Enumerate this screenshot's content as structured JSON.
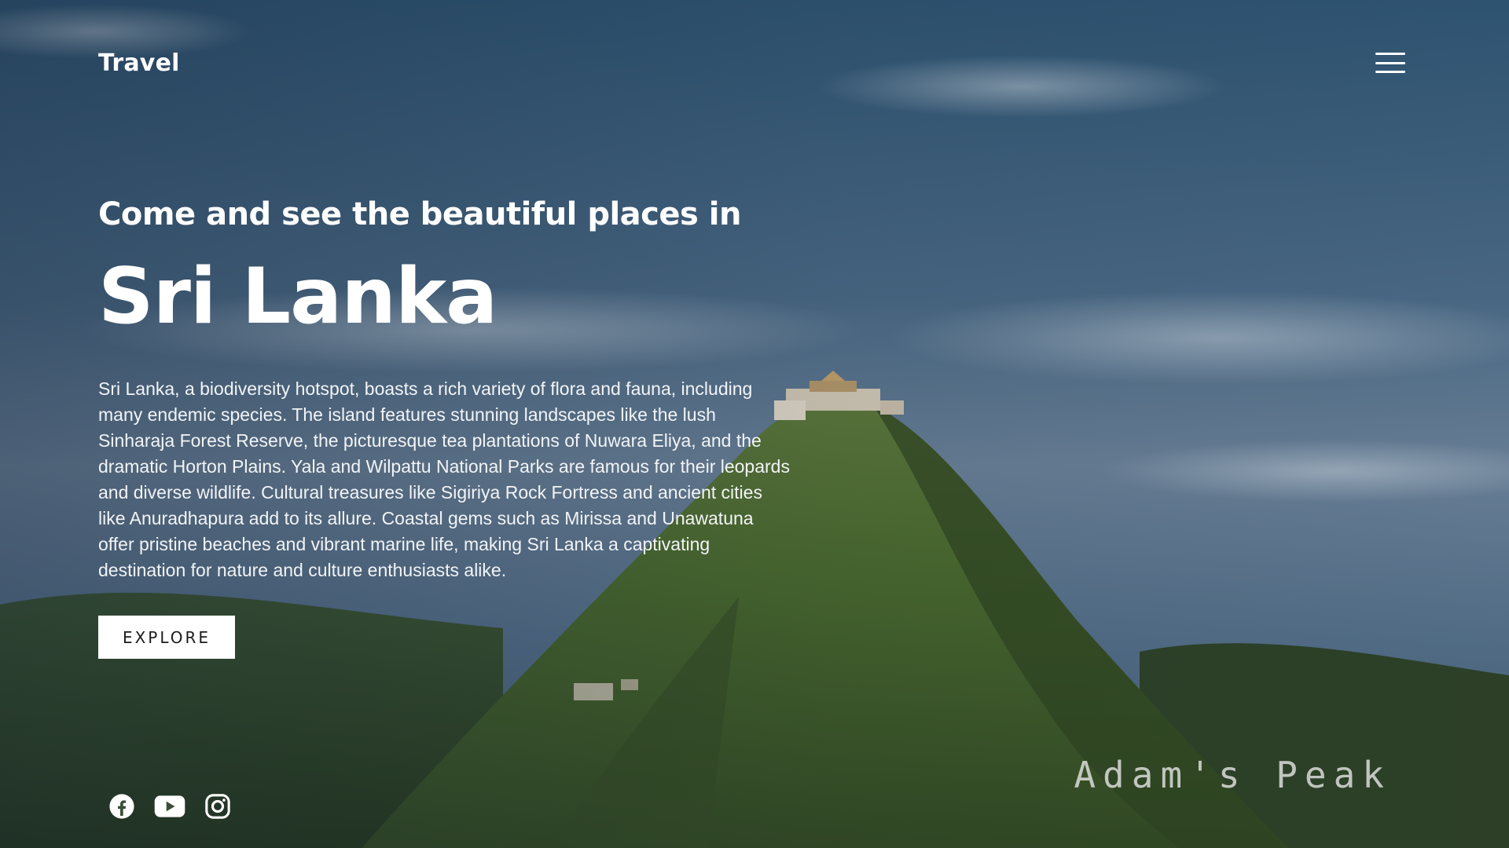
{
  "header": {
    "brand": "Travel",
    "menu_icon": "hamburger-menu-icon"
  },
  "hero": {
    "subtitle": "Come and see the beautiful places in",
    "title": "Sri Lanka",
    "description": "Sri Lanka, a biodiversity hotspot, boasts a rich variety of flora and fauna, including many endemic species. The island features stunning landscapes like the lush Sinharaja Forest Reserve, the picturesque tea plantations of Nuwara Eliya, and the dramatic Horton Plains. Yala and Wilpattu National Parks are famous for their leopards and diverse wildlife. Cultural treasures like Sigiriya Rock Fortress and ancient cities like Anuradhapura add to its allure. Coastal gems such as Mirissa and Unawatuna offer pristine beaches and vibrant marine life, making Sri Lanka a captivating destination for nature and culture enthusiasts alike.",
    "explore_label": "EXPLORE"
  },
  "social": [
    {
      "icon": "facebook-icon"
    },
    {
      "icon": "youtube-icon"
    },
    {
      "icon": "instagram-icon"
    }
  ],
  "place_label": "Adam's Peak",
  "colors": {
    "sky": "#3e5d78",
    "mountain": "#3f5a2a",
    "button_bg": "#ffffff",
    "text": "#ffffff"
  }
}
